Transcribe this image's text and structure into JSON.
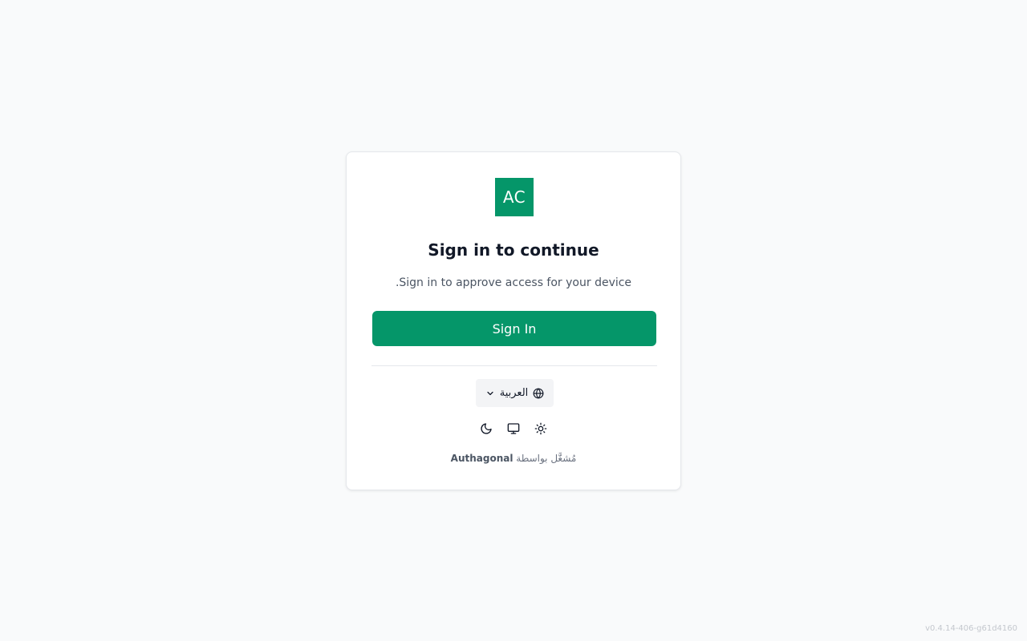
{
  "brand": {
    "logo_text": "AC",
    "logo_color": "#059669"
  },
  "header": {
    "title": "Sign in to continue",
    "subtitle": "Sign in to approve access for your device."
  },
  "actions": {
    "sign_in_label": "Sign In"
  },
  "language": {
    "selected": "العربية",
    "icon": "globe-icon"
  },
  "theme": {
    "options": [
      "dark",
      "system",
      "light"
    ]
  },
  "footer": {
    "powered_by": "مُشغَّل بواسطة",
    "brand_name": "Authagonal",
    "version": "v0.4.14-406-g61d4160"
  }
}
